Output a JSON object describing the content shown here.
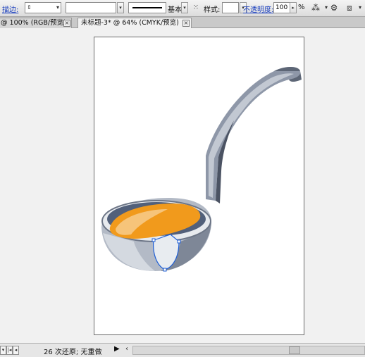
{
  "control_bar": {
    "stroke_label": "描边:",
    "stroke_weight": "",
    "brush_label": "基本",
    "style_label": "样式:",
    "opacity_label": "不透明度:",
    "opacity_value": "100",
    "opacity_unit": "%"
  },
  "tabs": [
    {
      "label": "@ 100% (RGB/预览)",
      "active": false
    },
    {
      "label": "未标题-3* @ 64% (CMYK/预览)",
      "active": true
    }
  ],
  "status_bar": {
    "history_text": "26 次还原; 无重做"
  },
  "colors": {
    "ladle_handle": "#8e97a8",
    "ladle_bowl": "#b9c0cb",
    "soup": "#f19a1c",
    "selection": "#1f5fd6"
  }
}
